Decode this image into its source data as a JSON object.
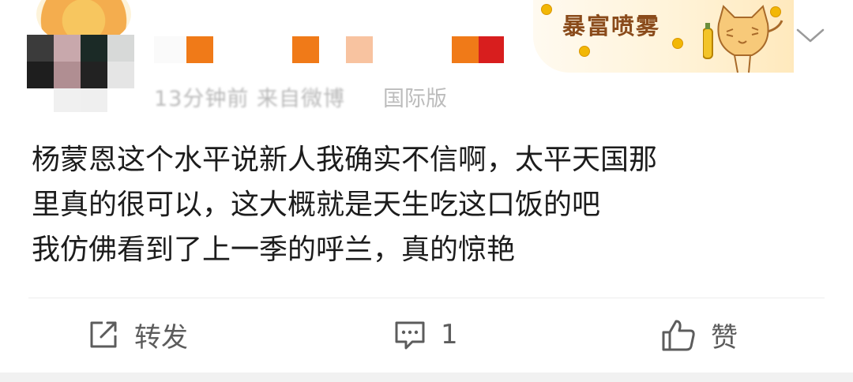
{
  "post": {
    "meta_clear_text": "国际版",
    "badge_text": "暴富喷雾",
    "content_lines": [
      "杨蒙恩这个水平说新人我确实不信啊，太平天国那",
      "里真的很可以，这大概就是天生吃这口饭的吧",
      "我仿佛看到了上一季的呼兰，真的惊艳"
    ]
  },
  "actions": {
    "repost_label": "转发",
    "comment_count": "1",
    "like_label": "赞"
  },
  "colors": {
    "badge_text": "#8a4b1b",
    "meta_text": "#b9b9b9",
    "accent_orange": "#f07a18"
  },
  "icons": [
    "lion-avatar-icon",
    "cat-icon",
    "chevron-down-icon",
    "repost-icon",
    "comment-icon",
    "like-icon"
  ]
}
